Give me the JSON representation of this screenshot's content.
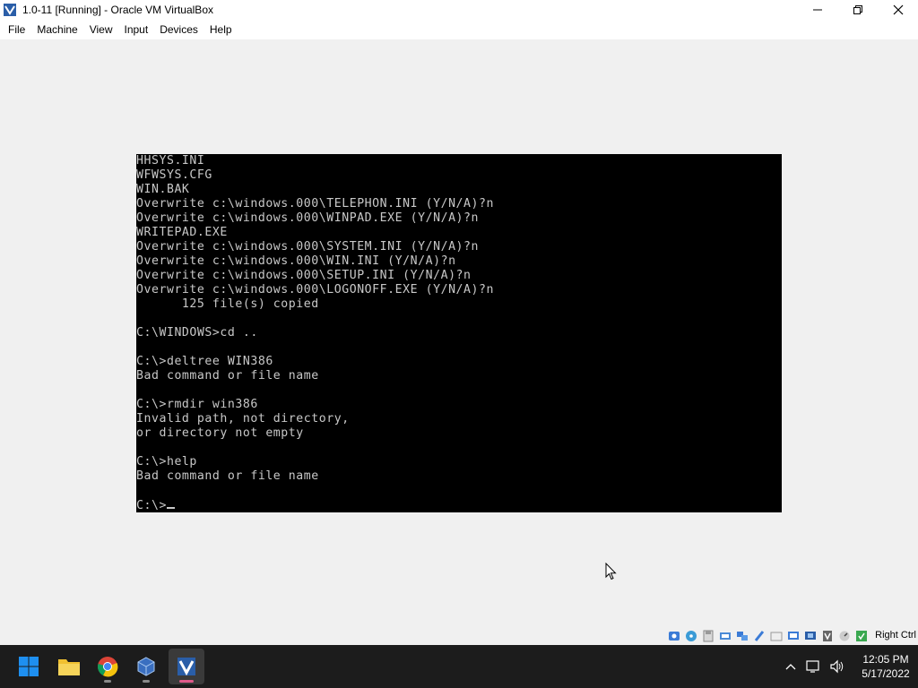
{
  "window": {
    "title": "1.0-11 [Running] - Oracle VM VirtualBox"
  },
  "menu": {
    "items": [
      "File",
      "Machine",
      "View",
      "Input",
      "Devices",
      "Help"
    ]
  },
  "console": {
    "lines": [
      "HHSYS.INI",
      "WFWSYS.CFG",
      "WIN.BAK",
      "Overwrite c:\\windows.000\\TELEPHON.INI (Y/N/A)?n",
      "Overwrite c:\\windows.000\\WINPAD.EXE (Y/N/A)?n",
      "WRITEPAD.EXE",
      "Overwrite c:\\windows.000\\SYSTEM.INI (Y/N/A)?n",
      "Overwrite c:\\windows.000\\WIN.INI (Y/N/A)?n",
      "Overwrite c:\\windows.000\\SETUP.INI (Y/N/A)?n",
      "Overwrite c:\\windows.000\\LOGONOFF.EXE (Y/N/A)?n",
      "      125 file(s) copied",
      "",
      "C:\\WINDOWS>cd ..",
      "",
      "C:\\>deltree WIN386",
      "Bad command or file name",
      "",
      "C:\\>rmdir win386",
      "Invalid path, not directory,",
      "or directory not empty",
      "",
      "C:\\>help",
      "Bad command or file name",
      ""
    ],
    "prompt": "C:\\>"
  },
  "statusbar": {
    "host_key": "Right Ctrl",
    "icons": [
      "hard-disk-icon",
      "optical-drive-icon",
      "floppy-icon",
      "audio-icon",
      "network-icon",
      "usb-icon",
      "shared-folders-icon",
      "display-icon",
      "video-capture-icon",
      "recording-icon",
      "cpu-icon",
      "mouse-integration-icon",
      "keyboard-icon"
    ]
  },
  "taskbar": {
    "apps": [
      "start-icon",
      "file-explorer-icon",
      "chrome-icon",
      "virtualbox-manager-icon",
      "virtualbox-vm-icon"
    ],
    "time": "12:05 PM",
    "date": "5/17/2022"
  },
  "colors": {
    "console_bg": "#000000",
    "console_fg": "#c8c8c8",
    "taskbar_bg": "#1c1c1c",
    "window_bg": "#f0f0f0"
  }
}
